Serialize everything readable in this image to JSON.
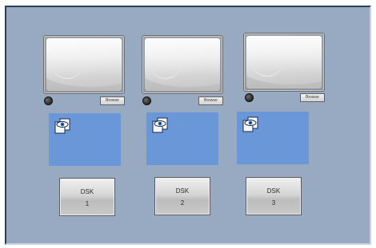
{
  "sources": [
    {
      "browse_label": "Browse",
      "dsk_line1": "DSK",
      "dsk_line2": "1"
    },
    {
      "browse_label": "Browse",
      "dsk_line1": "DSK",
      "dsk_line2": "2"
    },
    {
      "browse_label": "Browse",
      "dsk_line1": "DSK",
      "dsk_line2": "3"
    }
  ],
  "icons": {
    "panel_icon": "eye-document-icon",
    "status_icon": "status-dot-icon"
  },
  "colors": {
    "background": "#98aac2",
    "panel": "#6a97d8"
  }
}
